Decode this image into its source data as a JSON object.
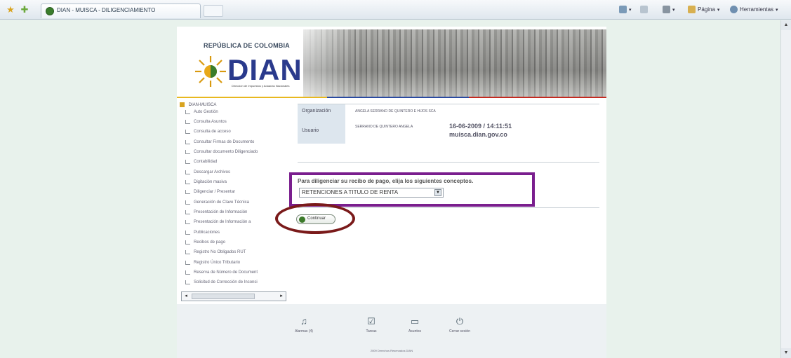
{
  "browser": {
    "tab_title": "DIAN - MUISCA - DILIGENCIAMIENTO",
    "page_menu_label": "Página",
    "tools_menu_label": "Herramientas"
  },
  "header": {
    "country": "REPÚBLICA DE COLOMBIA",
    "logo_text": "DIAN",
    "logo_subtitle": "Dirección de Impuestos y Aduanas Nacionales"
  },
  "sidebar": {
    "root_label": "DIAN-MUISCA",
    "items": [
      {
        "label": "Auto Gestión"
      },
      {
        "label": "Consulta Asuntos"
      },
      {
        "label": "Consulta de acceso"
      },
      {
        "label": "Consultar Firmas de Documento"
      },
      {
        "label": "Consultar documento Diligenciado"
      },
      {
        "label": "Contabilidad"
      },
      {
        "label": "Descargar Archivos"
      },
      {
        "label": "Digitación masiva"
      },
      {
        "label": "Diligenciar / Presentar"
      },
      {
        "label": "Generación de Clave Técnica"
      },
      {
        "label": "Presentación de Información"
      },
      {
        "label": "Presentación de Información a"
      },
      {
        "label": "Publicaciones"
      },
      {
        "label": "Recibos de pago"
      },
      {
        "label": "Registro No Obligados RUT"
      },
      {
        "label": "Registro Único Tributario"
      },
      {
        "label": "Reserva de Número de Document"
      },
      {
        "label": "Solicitud de Corrección de Inconsi"
      }
    ]
  },
  "info": {
    "org_label": "Organización",
    "org_value": "ANGELA SERRANO DE QUINTERO E HIJOS SCA",
    "user_label": "Usuario",
    "user_value": "SERRANO DE QUINTERO ANGELA",
    "datetime": "16-06-2009 / 14:11:51",
    "host": "muisca.dian.gov.co"
  },
  "concept": {
    "label": "Para diligenciar su recibo de pago, elija los siguientes conceptos.",
    "selected": "RETENCIONES A TITULO DE RENTA",
    "highlight_color": "#7a1e8e"
  },
  "continue_button": {
    "label": "Continuar",
    "highlight_color": "#7a1a1a"
  },
  "footer": {
    "items": [
      {
        "label": "Alarmas (4)",
        "icon": "bell-icon"
      },
      {
        "label": "Tareas",
        "icon": "tasks-icon"
      },
      {
        "label": "Asuntos",
        "icon": "folder-icon"
      },
      {
        "label": "Cerrar sesión",
        "icon": "power-icon"
      }
    ],
    "copyright": "2009 Derechos Reservados DIAN"
  }
}
